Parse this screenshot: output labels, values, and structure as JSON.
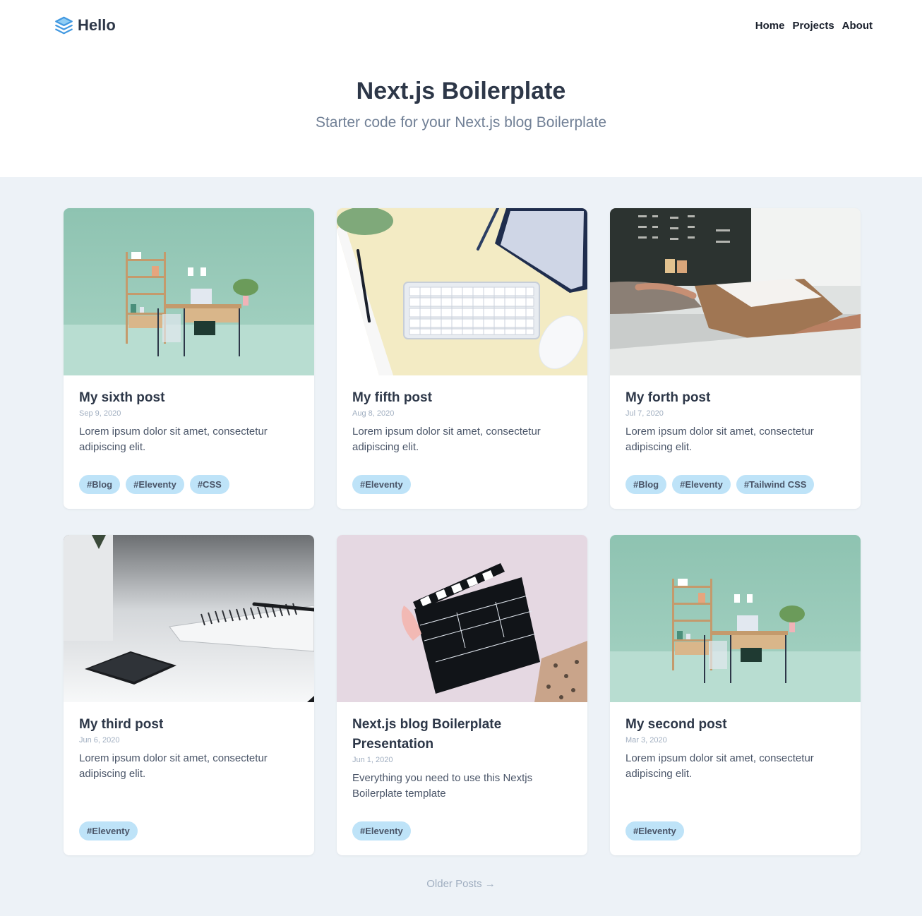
{
  "header": {
    "logo_text": "Hello",
    "nav": [
      "Home",
      "Projects",
      "About"
    ]
  },
  "hero": {
    "title": "Next.js Boilerplate",
    "subtitle": "Starter code for your Next.js blog Boilerplate"
  },
  "posts": [
    {
      "title": "My sixth post",
      "date": "Sep 9, 2020",
      "excerpt": "Lorem ipsum dolor sit amet, consectetur adipiscing elit.",
      "tags": [
        "#Blog",
        "#Eleventy",
        "#CSS"
      ],
      "image": "office-desk-teal"
    },
    {
      "title": "My fifth post",
      "date": "Aug 8, 2020",
      "excerpt": "Lorem ipsum dolor sit amet, consectetur adipiscing elit.",
      "tags": [
        "#Eleventy"
      ],
      "image": "keyboard-mouse-yellow"
    },
    {
      "title": "My forth post",
      "date": "Jul 7, 2020",
      "excerpt": "Lorem ipsum dolor sit amet, consectetur adipiscing elit.",
      "tags": [
        "#Blog",
        "#Eleventy",
        "#Tailwind CSS"
      ],
      "image": "box-handoff"
    },
    {
      "title": "My third post",
      "date": "Jun 6, 2020",
      "excerpt": "Lorem ipsum dolor sit amet, consectetur adipiscing elit.",
      "tags": [
        "#Eleventy"
      ],
      "image": "phone-notebook"
    },
    {
      "title": "Next.js blog Boilerplate Presentation",
      "date": "Jun 1, 2020",
      "excerpt": "Everything you need to use this Nextjs Boilerplate template",
      "tags": [
        "#Eleventy"
      ],
      "image": "clapperboard"
    },
    {
      "title": "My second post",
      "date": "Mar 3, 2020",
      "excerpt": "Lorem ipsum dolor sit amet, consectetur adipiscing elit.",
      "tags": [
        "#Eleventy"
      ],
      "image": "office-desk-teal"
    }
  ],
  "pagination": {
    "older_label": "Older Posts →"
  },
  "colors": {
    "accent": "#4299e1",
    "background": "#edf2f7",
    "tag_bg": "#bee3f8",
    "heading": "#2d3748",
    "muted": "#a0aec0"
  }
}
